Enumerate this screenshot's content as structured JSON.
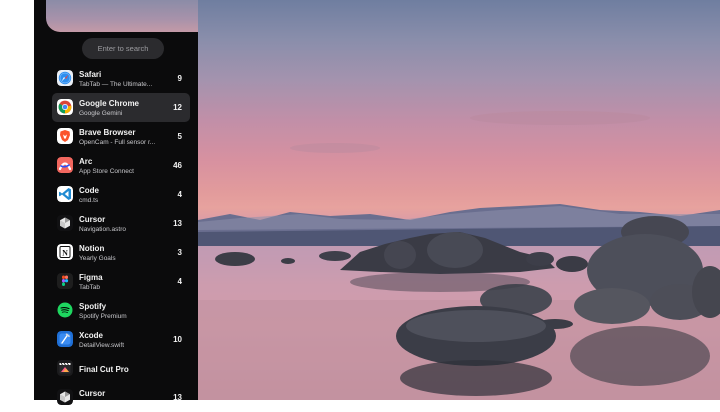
{
  "search": {
    "placeholder": "Enter to search"
  },
  "apps": [
    {
      "name": "Safari",
      "subtitle": "TabTab — The Ultimate...",
      "count": "9",
      "icon": "safari-icon",
      "selected": false
    },
    {
      "name": "Google Chrome",
      "subtitle": "Google Gemini",
      "count": "12",
      "icon": "chrome-icon",
      "selected": true
    },
    {
      "name": "Brave Browser",
      "subtitle": "OpenCam - Full sensor r...",
      "count": "5",
      "icon": "brave-icon",
      "selected": false
    },
    {
      "name": "Arc",
      "subtitle": "App Store Connect",
      "count": "46",
      "icon": "arc-icon",
      "selected": false
    },
    {
      "name": "Code",
      "subtitle": "cmd.ts",
      "count": "4",
      "icon": "vscode-icon",
      "selected": false
    },
    {
      "name": "Cursor",
      "subtitle": "Navigation.astro",
      "count": "13",
      "icon": "cursor-icon",
      "selected": false
    },
    {
      "name": "Notion",
      "subtitle": "Yearly Goals",
      "count": "3",
      "icon": "notion-icon",
      "selected": false
    },
    {
      "name": "Figma",
      "subtitle": "TabTab",
      "count": "4",
      "icon": "figma-icon",
      "selected": false
    },
    {
      "name": "Spotify",
      "subtitle": "Spotify Premium",
      "count": "",
      "icon": "spotify-icon",
      "selected": false
    },
    {
      "name": "Xcode",
      "subtitle": "DetailView.swift",
      "count": "10",
      "icon": "xcode-icon",
      "selected": false
    },
    {
      "name": "Final Cut Pro",
      "subtitle": "",
      "count": "",
      "icon": "final-cut-pro-icon",
      "selected": false
    },
    {
      "name": "Cursor",
      "subtitle": "",
      "count": "13",
      "icon": "cursor-icon",
      "selected": false
    }
  ]
}
